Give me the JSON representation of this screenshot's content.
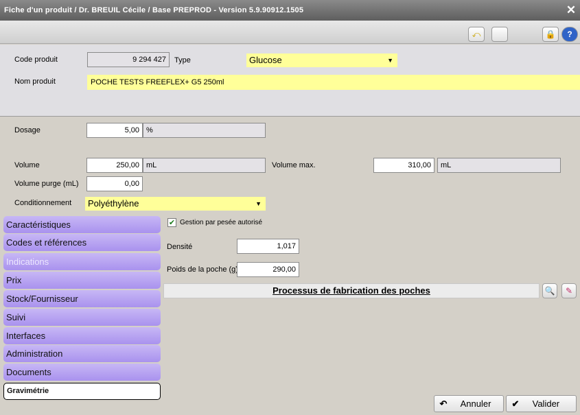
{
  "window": {
    "title": "Fiche d'un produit / Dr. BREUIL Cécile / Base PREPROD - Version 5.9.90912.1505"
  },
  "header": {
    "code_label": "Code produit",
    "code_value": "9 294 427",
    "type_label": "Type",
    "type_value": "Glucose",
    "name_label": "Nom produit",
    "name_value": "POCHE TESTS FREEFLEX+ G5 250ml"
  },
  "details": {
    "dosage_label": "Dosage",
    "dosage_value": "5,00",
    "dosage_unit": "%",
    "volume_label": "Volume",
    "volume_value": "250,00",
    "volume_unit": "mL",
    "volume_max_label": "Volume max.",
    "volume_max_value": "310,00",
    "volume_max_unit": "mL",
    "purge_label": "Volume purge (mL)",
    "purge_value": "0,00",
    "cond_label": "Conditionnement",
    "cond_value": "Polyéthylène"
  },
  "sidebar": {
    "items": [
      {
        "label": "Caractéristiques"
      },
      {
        "label": "Codes et références"
      },
      {
        "label": "Indications"
      },
      {
        "label": "Prix"
      },
      {
        "label": "Stock/Fournisseur"
      },
      {
        "label": "Suivi"
      },
      {
        "label": "Interfaces"
      },
      {
        "label": "Administration"
      },
      {
        "label": "Documents"
      },
      {
        "label": "Gravimétrie"
      }
    ]
  },
  "gravimetrie": {
    "checkbox_label": "Gestion par pesée autorisé",
    "densite_label": "Densité",
    "densite_value": "1,017",
    "poids_label": "Poids de la poche (g)",
    "poids_value": "290,00",
    "section_title": "Processus de fabrication des poches"
  },
  "footer": {
    "cancel_label": "Annuler",
    "validate_label": "Valider"
  },
  "icons": {
    "close": "close-icon",
    "back": "back-icon",
    "lock": "lock-icon",
    "help": "help-icon",
    "zoom": "zoom-icon",
    "edit": "edit-icon",
    "check": "check-icon",
    "undo": "undo-icon"
  }
}
